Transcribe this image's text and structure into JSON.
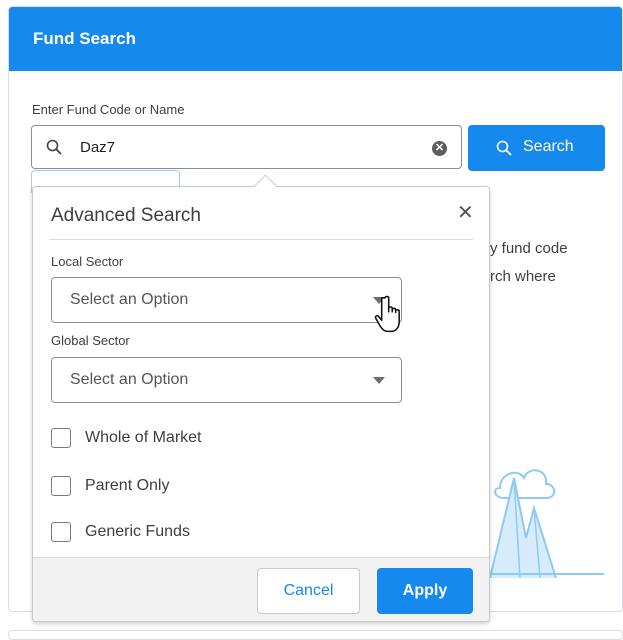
{
  "header": {
    "title": "Fund Search"
  },
  "search": {
    "label": "Enter Fund Code or Name",
    "value": "Daz7",
    "button_label": "Search"
  },
  "background_text": {
    "line1": "y fund code",
    "line2": "rch where"
  },
  "advanced": {
    "title": "Advanced Search",
    "local_sector_label": "Local Sector",
    "local_sector_value": "Select an Option",
    "global_sector_label": "Global Sector",
    "global_sector_value": "Select an Option",
    "checkboxes": [
      {
        "label": "Whole of Market",
        "checked": false
      },
      {
        "label": "Parent Only",
        "checked": false
      },
      {
        "label": "Generic Funds",
        "checked": false
      }
    ],
    "cancel_label": "Cancel",
    "apply_label": "Apply"
  },
  "colors": {
    "brand": "#1589ee",
    "illustration": "#8fc9f5"
  },
  "icons": [
    "search-icon",
    "clear-icon",
    "close-icon",
    "chevron-down-icon",
    "hand-cursor-icon"
  ]
}
